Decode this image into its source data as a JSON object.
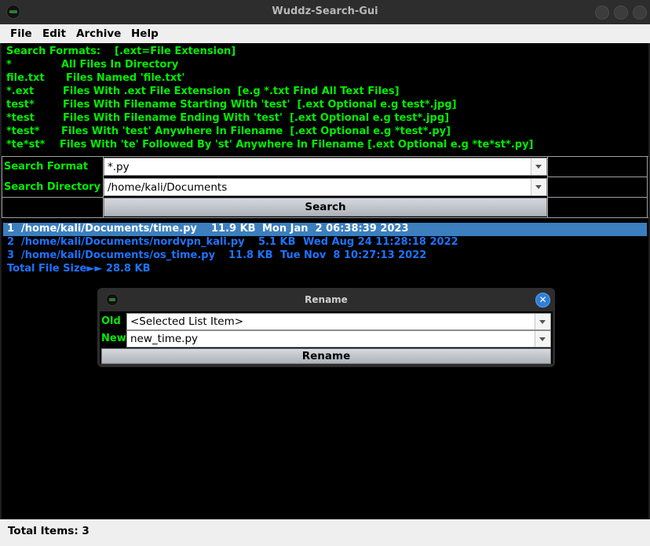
{
  "window": {
    "title": "Wuddz-Search-Gui"
  },
  "menu": {
    "file": "File",
    "edit": "Edit",
    "archive": "Archive",
    "help": "Help"
  },
  "help": {
    "header_key": "Search Formats:",
    "header_desc": "[.ext=File Extension]",
    "lines": [
      {
        "key": "*",
        "desc": "All Files In Directory"
      },
      {
        "key": "file.txt",
        "desc": "Files Named 'file.txt'"
      },
      {
        "key": "*.ext",
        "desc": "Files With .ext File Extension  [e.g *.txt Find All Text Files]"
      },
      {
        "key": "test*",
        "desc": "Files With Filename Starting With 'test'  [.ext Optional e.g test*.jpg]"
      },
      {
        "key": "*test",
        "desc": "Files With Filename Ending With 'test'  [.ext Optional e.g test*.jpg]"
      },
      {
        "key": "*test*",
        "desc": "Files With 'test' Anywhere In Filename  [.ext Optional e.g *test*.py]"
      },
      {
        "key": "*te*st*",
        "desc": "Files With 'te' Followed By 'st' Anywhere In Filename [.ext Optional e.g *te*st*.py]"
      }
    ]
  },
  "form": {
    "search_format_label": "Search Format",
    "search_format_value": "*.py",
    "search_directory_label": "Search Directory",
    "search_directory_value": "/home/kali/Documents",
    "search_button": "Search"
  },
  "results": {
    "rows": [
      {
        "num": "1",
        "path": "/home/kali/Documents/time.py",
        "size": "11.9 KB",
        "date": "Mon Jan  2 06:38:39 2023",
        "selected": true
      },
      {
        "num": "2",
        "path": "/home/kali/Documents/nordvpn_kali.py",
        "size": "5.1 KB",
        "date": "Wed Aug 24 11:28:18 2022",
        "selected": false
      },
      {
        "num": "3",
        "path": "/home/kali/Documents/os_time.py",
        "size": "11.8 KB",
        "date": "Tue Nov  8 10:27:13 2022",
        "selected": false
      }
    ],
    "total": "Total File Size►► 28.8 KB"
  },
  "status": {
    "text": "Total Items: 3"
  },
  "dialog": {
    "title": "Rename",
    "close_glyph": "✕",
    "old_label": "Old",
    "old_value": "<Selected List Item>",
    "new_label": "New",
    "new_value": "new_time.py",
    "button": "Rename"
  },
  "colors": {
    "accent": "#00ee00",
    "link": "#1e73ff",
    "selection": "#3b7fbe",
    "close": "#2f7fd8"
  }
}
